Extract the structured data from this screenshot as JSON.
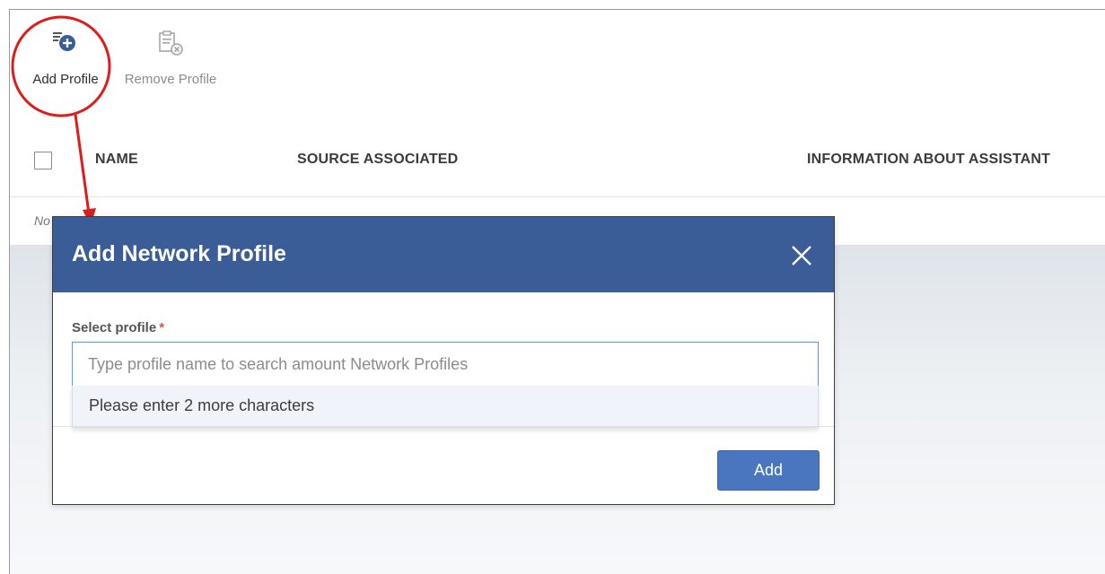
{
  "toolbar": {
    "add_profile": {
      "label": "Add Profile",
      "icon": "add-profile-icon"
    },
    "remove_profile": {
      "label": "Remove Profile",
      "icon": "remove-profile-icon"
    }
  },
  "table": {
    "columns": [
      "NAME",
      "SOURCE ASSOCIATED",
      "INFORMATION ABOUT ASSISTANT"
    ],
    "empty_text": "No results found"
  },
  "dialog": {
    "title": "Add Network Profile",
    "field_label": "Select profile",
    "required_marker": "*",
    "search_placeholder": "Type profile name to search amount Network Profiles",
    "search_value": "",
    "dropdown_message": "Please enter 2 more characters",
    "add_button": "Add"
  },
  "colors": {
    "dialog_header": "#3a5c97",
    "primary_button": "#4a76c0",
    "annotation": "#e01b1b",
    "input_focus_border": "#5b9bd5"
  }
}
